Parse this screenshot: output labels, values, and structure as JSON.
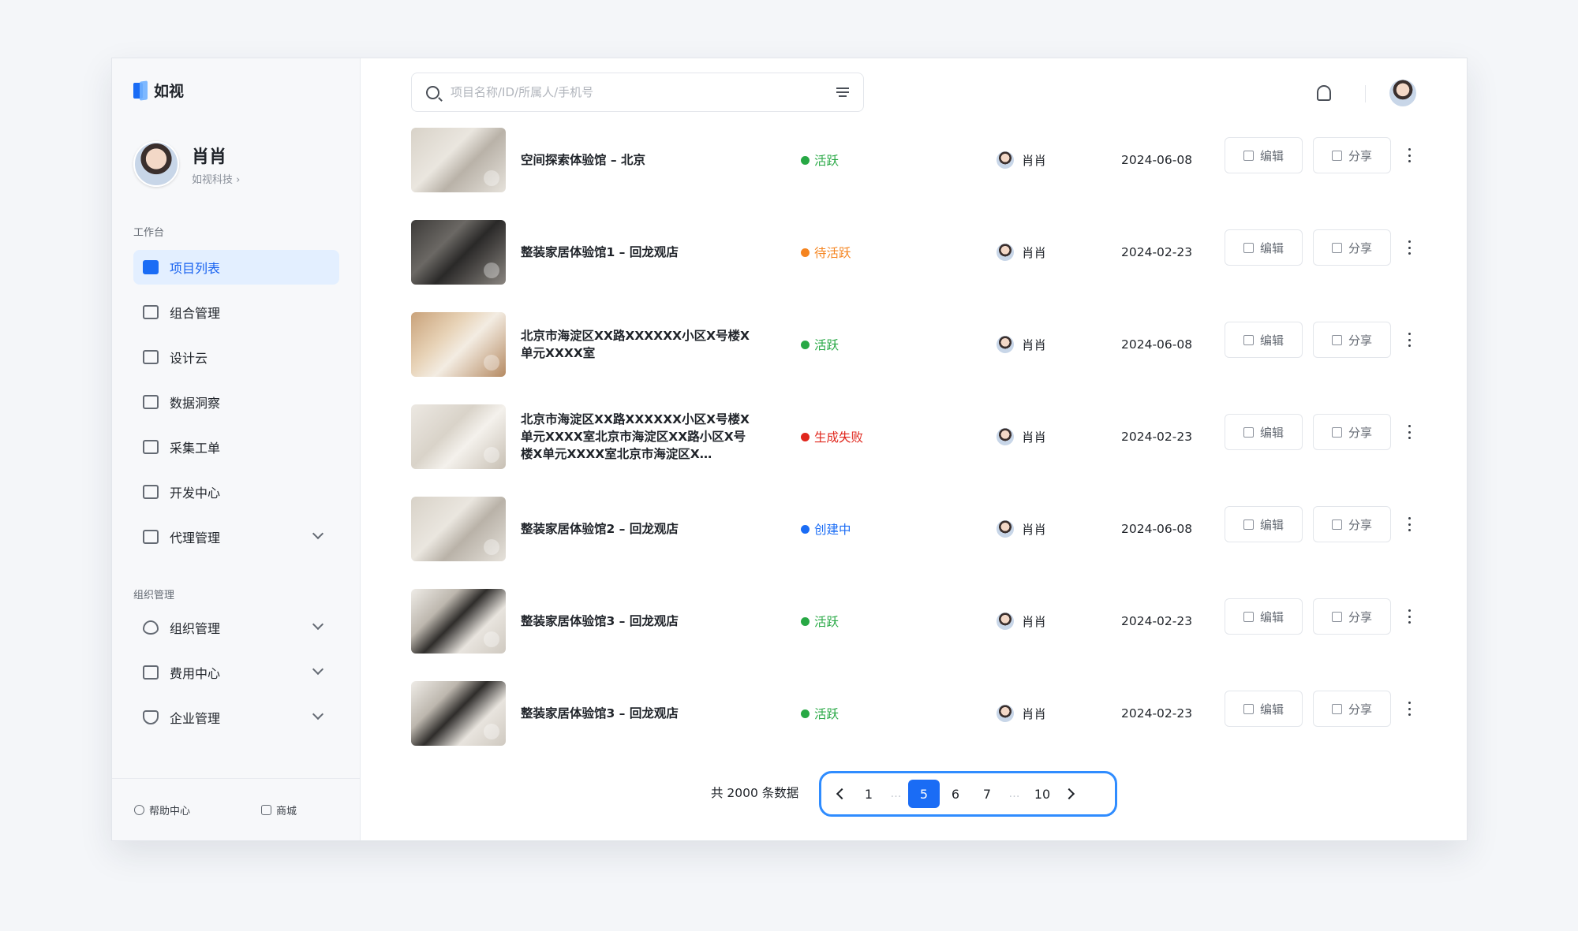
{
  "app": {
    "logo_text": "如视"
  },
  "profile": {
    "name": "肖肖",
    "org": "如视科技 ›"
  },
  "sidebar": {
    "section_workbench": "工作台",
    "section_org": "组织管理",
    "items": [
      {
        "label": "项目列表",
        "icon": "video-icon",
        "active": true
      },
      {
        "label": "组合管理",
        "icon": "folder-icon"
      },
      {
        "label": "设计云",
        "icon": "document-icon"
      },
      {
        "label": "数据洞察",
        "icon": "chart-icon"
      },
      {
        "label": "采集工单",
        "icon": "form-icon"
      },
      {
        "label": "开发中心",
        "icon": "monitor-icon"
      },
      {
        "label": "代理管理",
        "icon": "briefcase-icon",
        "expandable": true
      }
    ],
    "org_items": [
      {
        "label": "组织管理",
        "icon": "heart-icon",
        "expandable": true
      },
      {
        "label": "费用中心",
        "icon": "wallet-icon",
        "expandable": true
      },
      {
        "label": "企业管理",
        "icon": "shield-icon",
        "expandable": true
      }
    ],
    "footer": {
      "help": "帮助中心",
      "shop": "商城"
    }
  },
  "search": {
    "placeholder": "项目名称/ID/所属人/手机号",
    "value": ""
  },
  "colors": {
    "accent": "#1a6cf5",
    "active": "#27a844",
    "pending": "#f5841f",
    "failed": "#e0261c",
    "creating": "#1a6cf5"
  },
  "actions": {
    "edit": "编辑",
    "share": "分享"
  },
  "projects": [
    {
      "title": "空间探索体验馆 – 北京",
      "status": "活跃",
      "status_type": "active",
      "owner": "肖肖",
      "date": "2024-06-08"
    },
    {
      "title": "整装家居体验馆1 – 回龙观店",
      "status": "待活跃",
      "status_type": "pending",
      "owner": "肖肖",
      "date": "2024-02-23"
    },
    {
      "title": "北京市海淀区XX路XXXXXX小区X号楼X单元XXXX室",
      "status": "活跃",
      "status_type": "active",
      "owner": "肖肖",
      "date": "2024-06-08"
    },
    {
      "title": "北京市海淀区XX路XXXXXX小区X号楼X单元XXXX室北京市海淀区XX路小区X号楼X单元XXXX室北京市海淀区X…",
      "status": "生成失败",
      "status_type": "failed",
      "owner": "肖肖",
      "date": "2024-02-23"
    },
    {
      "title": "整装家居体验馆2 – 回龙观店",
      "status": "创建中",
      "status_type": "creating",
      "owner": "肖肖",
      "date": "2024-06-08"
    },
    {
      "title": "整装家居体验馆3 – 回龙观店",
      "status": "活跃",
      "status_type": "active",
      "owner": "肖肖",
      "date": "2024-02-23"
    },
    {
      "title": "整装家居体验馆3 – 回龙观店",
      "status": "活跃",
      "status_type": "active",
      "owner": "肖肖",
      "date": "2024-02-23"
    }
  ],
  "pagination": {
    "total_text": "共 2000 条数据",
    "pages": [
      "1",
      "…",
      "5",
      "6",
      "7",
      "…",
      "10"
    ],
    "current": "5"
  }
}
